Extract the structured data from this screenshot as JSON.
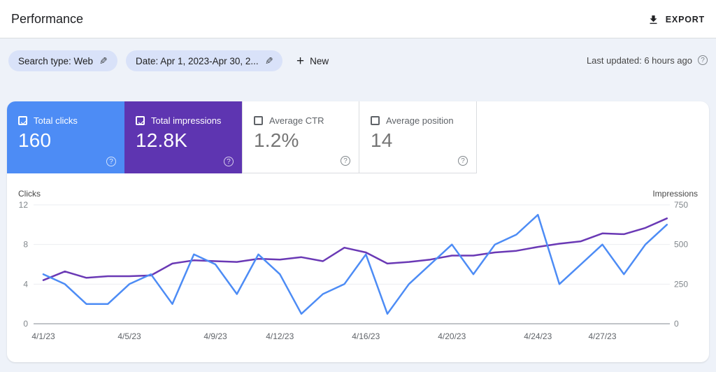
{
  "header": {
    "title": "Performance",
    "export_label": "EXPORT"
  },
  "filters": {
    "search_type_chip": "Search type: Web",
    "date_chip": "Date: Apr 1, 2023-Apr 30, 2...",
    "new_label": "New",
    "last_updated": "Last updated: 6 hours ago",
    "help_glyph": "?"
  },
  "metric_cards": [
    {
      "label": "Total clicks",
      "value": "160",
      "checked": true,
      "bg": "#4d8cf5"
    },
    {
      "label": "Total impressions",
      "value": "12.8K",
      "checked": true,
      "bg": "#5e35b1"
    },
    {
      "label": "Average CTR",
      "value": "1.2%",
      "checked": false,
      "bg": "#ffffff"
    },
    {
      "label": "Average position",
      "value": "14",
      "checked": false,
      "bg": "#ffffff"
    }
  ],
  "chart_data": {
    "type": "line",
    "x": [
      "4/1/23",
      "4/2/23",
      "4/3/23",
      "4/4/23",
      "4/5/23",
      "4/6/23",
      "4/7/23",
      "4/8/23",
      "4/9/23",
      "4/10/23",
      "4/11/23",
      "4/12/23",
      "4/13/23",
      "4/14/23",
      "4/15/23",
      "4/16/23",
      "4/17/23",
      "4/18/23",
      "4/19/23",
      "4/20/23",
      "4/21/23",
      "4/22/23",
      "4/23/23",
      "4/24/23",
      "4/25/23",
      "4/26/23",
      "4/27/23",
      "4/28/23",
      "4/29/23",
      "4/30/23"
    ],
    "x_tick_indices": [
      0,
      4,
      8,
      11,
      15,
      19,
      23,
      26
    ],
    "x_tick_labels": [
      "4/1/23",
      "4/5/23",
      "4/9/23",
      "4/12/23",
      "4/16/23",
      "4/20/23",
      "4/24/23",
      "4/27/23"
    ],
    "series": [
      {
        "name": "Clicks",
        "axis": "left",
        "color": "#4d8cf5",
        "values": [
          5,
          4,
          2,
          2,
          4,
          5,
          2,
          7,
          6,
          3,
          7,
          5,
          1,
          3,
          4,
          7,
          1,
          4,
          6,
          8,
          5,
          8,
          9,
          11,
          4,
          6,
          8,
          5,
          8,
          10
        ]
      },
      {
        "name": "Impressions",
        "axis": "right",
        "color": "#6a39b5",
        "values": [
          275,
          330,
          290,
          300,
          300,
          305,
          380,
          400,
          395,
          390,
          410,
          405,
          420,
          395,
          480,
          450,
          380,
          390,
          405,
          430,
          430,
          450,
          460,
          485,
          505,
          520,
          570,
          565,
          605,
          665
        ]
      }
    ],
    "left_axis": {
      "label": "Clicks",
      "ticks": [
        0,
        4,
        8,
        12
      ],
      "max": 12
    },
    "right_axis": {
      "label": "Impressions",
      "ticks": [
        0,
        250,
        500,
        750
      ],
      "max": 750
    },
    "grid": true,
    "legend_position": "none",
    "colors": {
      "grid_line": "#ebedf0",
      "zero_line": "#9aa0a6",
      "tick_text": "#80868b",
      "x_label_text": "#5f6368",
      "axis_title_text": "#474747"
    }
  }
}
